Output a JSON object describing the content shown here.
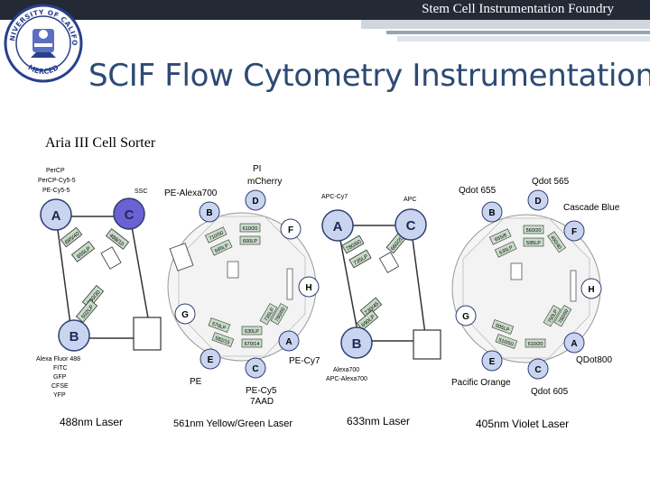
{
  "header": {
    "foundry_name": "Stem Cell Instrumentation Foundry"
  },
  "logo": {
    "top_text": "THE UNIVERSITY OF CALIFORNIA",
    "bottom_text": "MERCED"
  },
  "slide": {
    "title": "SCIF Flow Cytometry Instrumentation",
    "subtitle": "Aria III Cell Sorter"
  },
  "colors": {
    "topbar": "#232a35",
    "title": "#2c4a73",
    "node_a": "#c9d5f0",
    "node_c_active": "#6a62d2",
    "filter": "#c8dcc8"
  },
  "laser488": {
    "caption": "488nm Laser",
    "node_a": "A",
    "node_b": "B",
    "node_c": "C",
    "top_labels": [
      "PerCP",
      "PerCP-Cy5-5",
      "PE-Cy5-5"
    ],
    "ssc_label": "SSC",
    "bottom_labels": [
      "Alexa Fluor 488",
      "FITC",
      "GFP",
      "CFSE",
      "YFP"
    ],
    "filters": [
      "695/40",
      "655LP",
      "488/10",
      "530/30",
      "502LP"
    ]
  },
  "laser561": {
    "caption": "561nm Yellow/Green Laser",
    "nodes": [
      "B",
      "D",
      "F",
      "H",
      "A",
      "C",
      "E",
      "G"
    ],
    "labels": {
      "pe_alexa700": "PE-Alexa700",
      "pi": "PI",
      "mcherry": "mCherry",
      "pe_cy7": "PE-Cy7",
      "pe_cy5": "PE-Cy5",
      "aad": "7AAD",
      "pe": "PE"
    },
    "filters": [
      "710/50",
      "685LP",
      "610/20",
      "600LP",
      "780/60",
      "735LP",
      "670/14",
      "630LP",
      "582/15",
      "570LP"
    ]
  },
  "laser633": {
    "caption": "633nm Laser",
    "node_a": "A",
    "node_b": "B",
    "node_c": "C",
    "labels": {
      "apc_cy7": "APC-Cy7",
      "apc": "APC",
      "alexa700": "Alexa700",
      "apc_alexa700": "APC-Alexa700"
    },
    "filters": [
      "780/60",
      "735LP",
      "660/20",
      "730/45",
      "690LP"
    ]
  },
  "laser405": {
    "caption": "405nm Violet Laser",
    "nodes": [
      "B",
      "D",
      "F",
      "H",
      "A",
      "C",
      "E",
      "G"
    ],
    "labels": {
      "qdot655": "Qdot 655",
      "qdot565": "Qdot 565",
      "cascade_blue": "Cascade Blue",
      "qdot800": "QDot800",
      "qdot605": "Qdot 605",
      "pacific_orange": "Pacific Orange"
    },
    "filters": [
      "655/8",
      "635LP",
      "560/20",
      "595LP",
      "450/40",
      "780/60",
      "750LP",
      "610/20",
      "510/50",
      "505LP"
    ]
  }
}
